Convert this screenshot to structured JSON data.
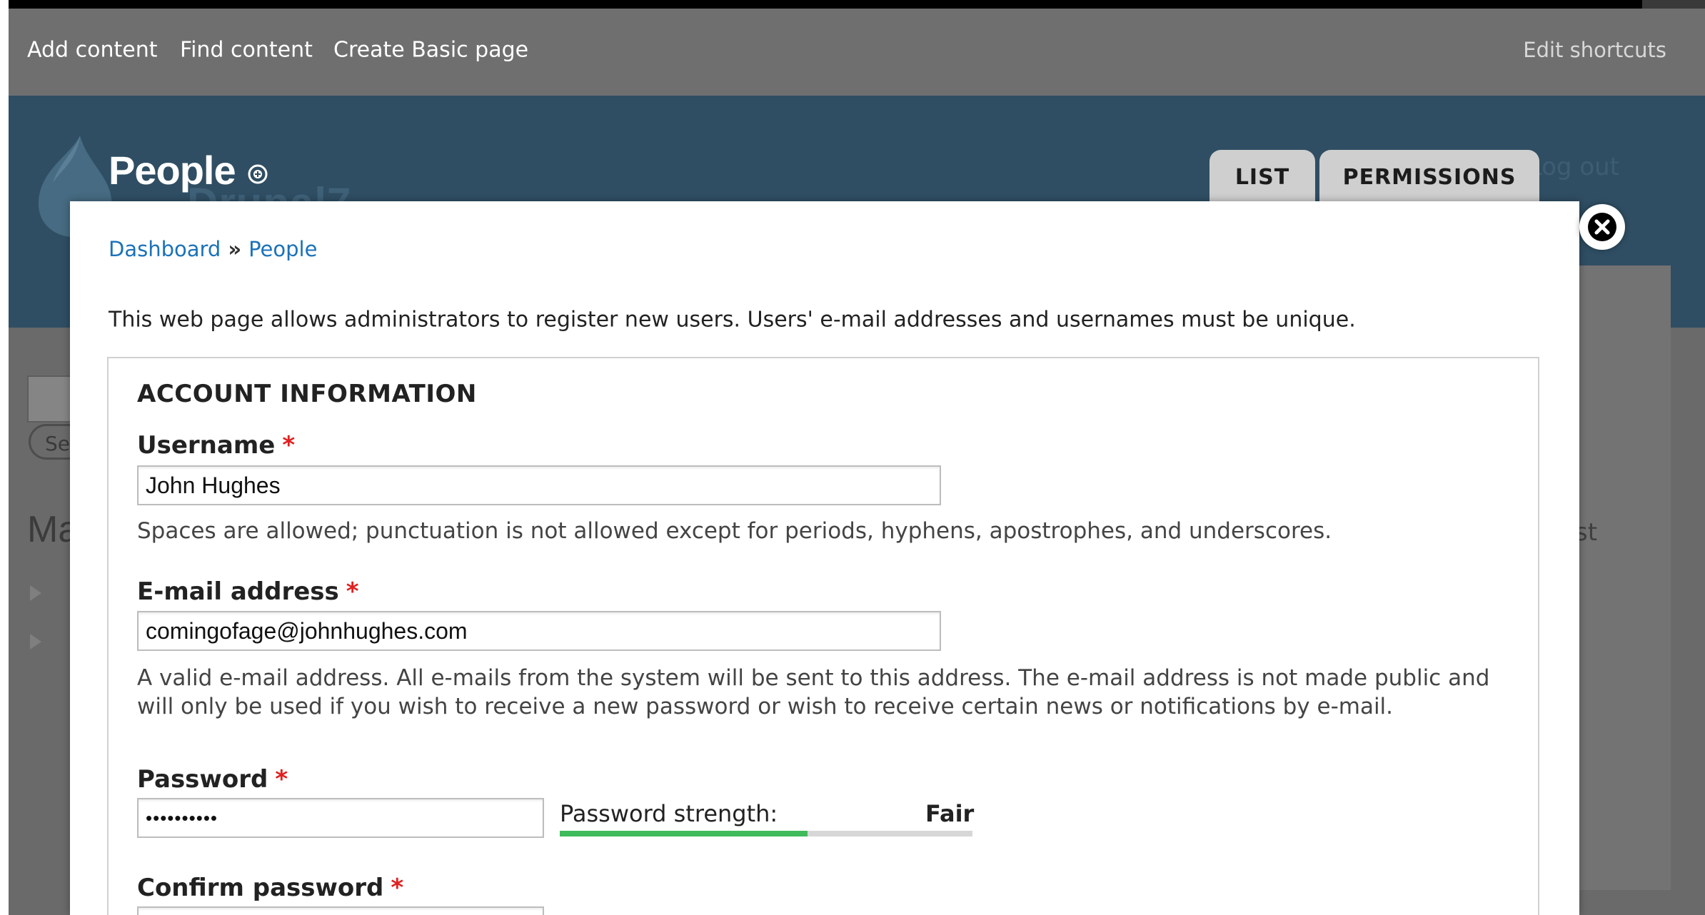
{
  "shortcuts": {
    "items": [
      "Add content",
      "Find content",
      "Create Basic page"
    ],
    "edit_label": "Edit shortcuts"
  },
  "header": {
    "title": "People",
    "logo_text": "Drupal7",
    "logout_bg": "Log out"
  },
  "tabs": [
    {
      "label": "LIST"
    },
    {
      "label": "PERMISSIONS"
    }
  ],
  "background": {
    "search_button": "Se",
    "heading": "Ma",
    "right_text": "st"
  },
  "breadcrumb": {
    "items": [
      "Dashboard",
      "People"
    ],
    "separator": "»"
  },
  "intro": "This web page allows administrators to register new users. Users' e-mail addresses and usernames must be unique.",
  "account": {
    "legend": "ACCOUNT INFORMATION",
    "required_marker": "*",
    "username": {
      "label": "Username",
      "value": "John Hughes",
      "description": "Spaces are allowed; punctuation is not allowed except for periods, hyphens, apostrophes, and underscores."
    },
    "email": {
      "label": "E-mail address",
      "value": "comingofage@johnhughes.com",
      "description_line1": "A valid e-mail address. All e-mails from the system will be sent to this address. The e-mail address is not made public and",
      "description_line2": "will only be used if you wish to receive a new password or wish to receive certain news or notifications by e-mail."
    },
    "password": {
      "label": "Password",
      "value_masked": "••••••••••",
      "strength_label": "Password strength:",
      "strength_value": "Fair",
      "strength_fraction": 0.6
    },
    "confirm_password": {
      "label": "Confirm password"
    }
  },
  "colors": {
    "accent_link": "#1b72b8",
    "required": "#e02020",
    "strength_fill": "#3fbb5c",
    "header_bg": "#2f4e63",
    "shortcut_bg": "#6f6f6f"
  },
  "icons": {
    "close": "close-icon",
    "add": "add-circle-icon",
    "logo": "drupal-drop-icon"
  }
}
